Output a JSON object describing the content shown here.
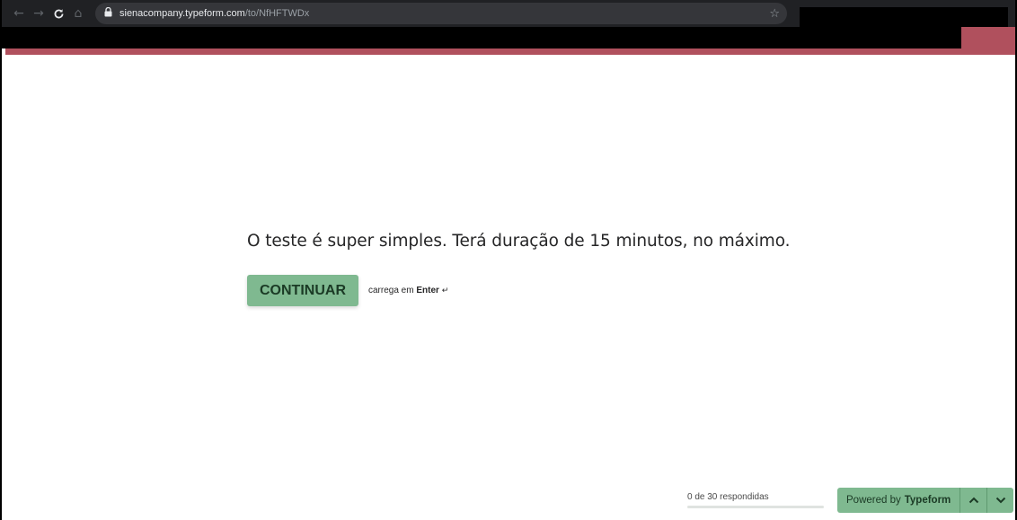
{
  "browser": {
    "back_icon": "←",
    "forward_icon": "→",
    "reload_icon": "C",
    "home_icon": "⌂",
    "lock_icon": "🔒",
    "url_host": "sienacompany.typeform.com",
    "url_path": "/to/NfHFTWDx",
    "star_icon": "☆"
  },
  "form": {
    "question": "O teste é super simples. Terá duração de 15 minutos, no máximo.",
    "continue_label": "CONTINUAR",
    "hint_prefix": "carrega em ",
    "hint_key": "Enter",
    "hint_icon": "↵"
  },
  "footer": {
    "progress_text": "0 de 30 respondidas",
    "progress_fraction": 0,
    "powered_prefix": "Powered by",
    "powered_brand": "Typeform"
  },
  "colors": {
    "accent": "#b0505d",
    "button": "#7fb990",
    "button_text": "#1b3a25",
    "chrome": "#202124"
  }
}
